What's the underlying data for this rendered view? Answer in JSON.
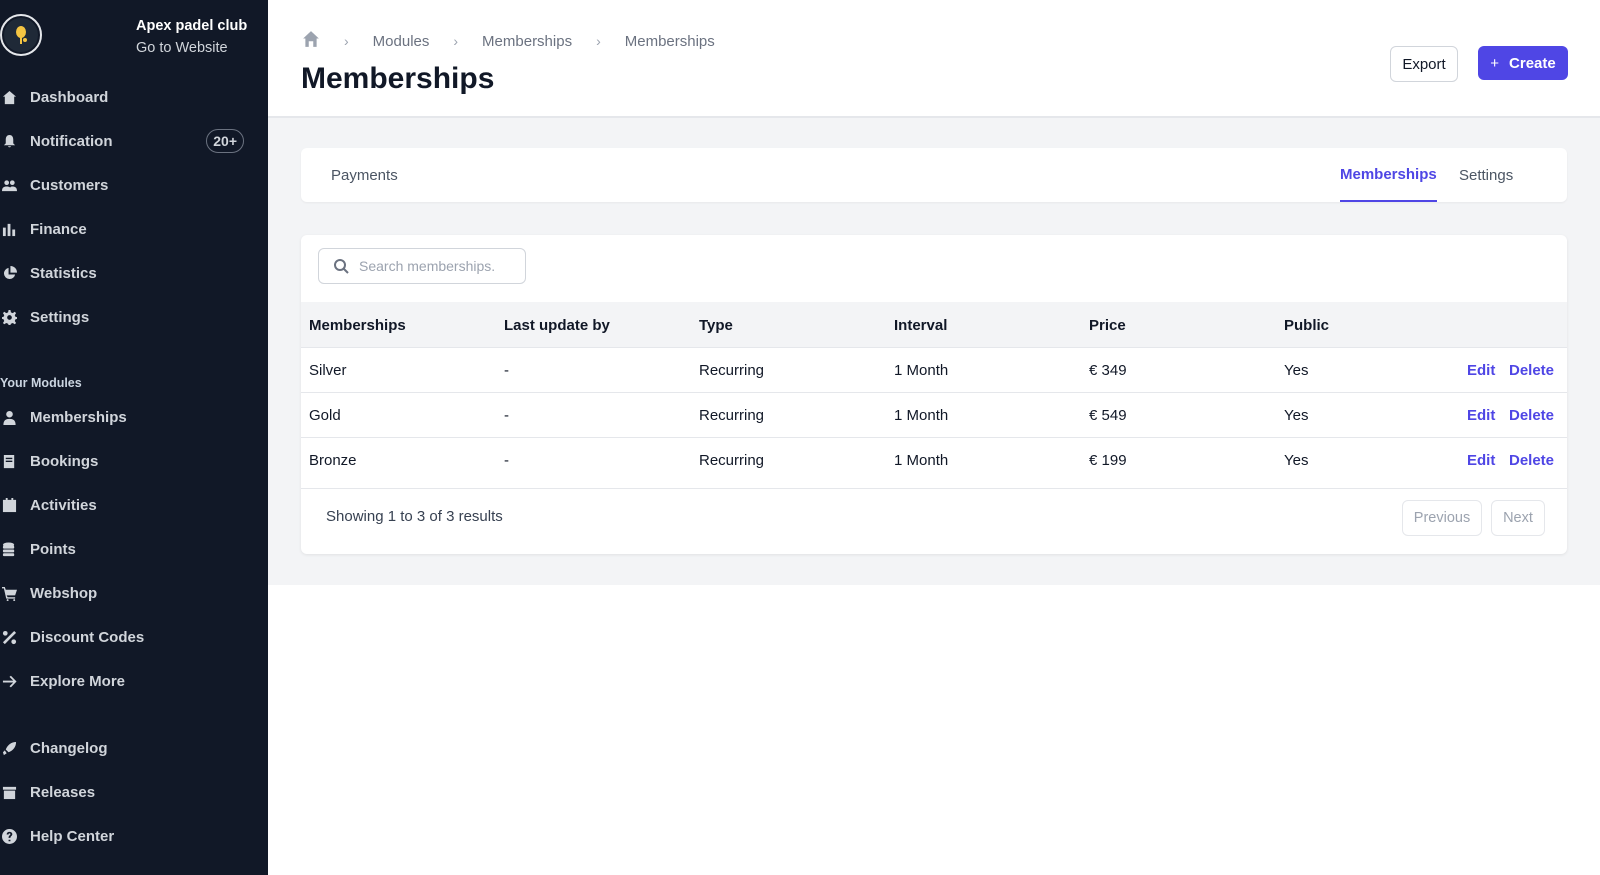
{
  "brand": {
    "name": "Apex padel club",
    "link": "Go to Website",
    "logo_icon": "padel-racket-icon"
  },
  "sidebar": {
    "main": [
      {
        "label": "Dashboard",
        "icon": "home-icon"
      },
      {
        "label": "Notification",
        "icon": "bell-icon",
        "badge": "20+"
      },
      {
        "label": "Customers",
        "icon": "users-icon"
      },
      {
        "label": "Finance",
        "icon": "bar-chart-icon"
      },
      {
        "label": "Statistics",
        "icon": "pie-chart-icon"
      },
      {
        "label": "Settings",
        "icon": "gear-icon"
      }
    ],
    "section_title": "Your Modules",
    "modules": [
      {
        "label": "Memberships",
        "icon": "user-icon"
      },
      {
        "label": "Bookings",
        "icon": "book-icon"
      },
      {
        "label": "Activities",
        "icon": "calendar-icon"
      },
      {
        "label": "Points",
        "icon": "coins-icon"
      },
      {
        "label": "Webshop",
        "icon": "cart-icon"
      },
      {
        "label": "Discount Codes",
        "icon": "percent-icon"
      },
      {
        "label": "Explore More",
        "icon": "arrow-right-icon"
      }
    ],
    "footer": [
      {
        "label": "Changelog",
        "icon": "rocket-icon"
      },
      {
        "label": "Releases",
        "icon": "box-icon"
      },
      {
        "label": "Help Center",
        "icon": "help-icon"
      }
    ]
  },
  "header": {
    "breadcrumb": [
      "Modules",
      "Memberships",
      "Memberships"
    ],
    "title": "Memberships",
    "export_label": "Export",
    "create_label": "Create"
  },
  "tabs": {
    "left": "Payments",
    "right": [
      "Memberships",
      "Settings"
    ],
    "active": "Memberships"
  },
  "search": {
    "placeholder": "Search memberships."
  },
  "table": {
    "columns": [
      "Memberships",
      "Last update by",
      "Type",
      "Interval",
      "Price",
      "Public"
    ],
    "rows": [
      {
        "name": "Silver",
        "updated_by": "-",
        "type": "Recurring",
        "interval": "1 Month",
        "price": "€ 349",
        "public": "Yes"
      },
      {
        "name": "Gold",
        "updated_by": "-",
        "type": "Recurring",
        "interval": "1 Month",
        "price": "€ 549",
        "public": "Yes"
      },
      {
        "name": "Bronze",
        "updated_by": "-",
        "type": "Recurring",
        "interval": "1 Month",
        "price": "€ 199",
        "public": "Yes"
      }
    ],
    "edit_label": "Edit",
    "delete_label": "Delete"
  },
  "pagination": {
    "summary": "Showing 1 to 3 of 3 results",
    "previous": "Previous",
    "next": "Next"
  },
  "colors": {
    "sidebar_bg": "#111827",
    "accent": "#4f46e5",
    "content_bg": "#f3f4f6"
  }
}
